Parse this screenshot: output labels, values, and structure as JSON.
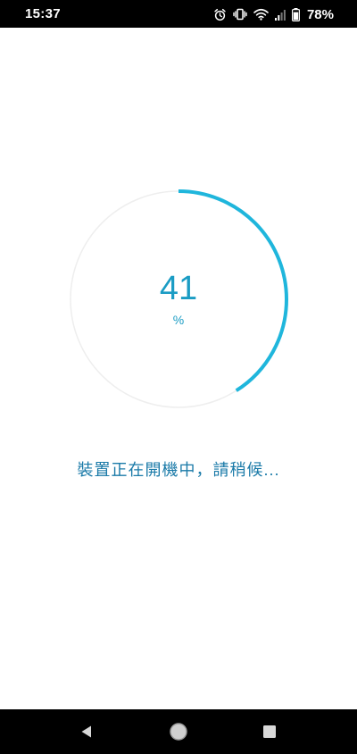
{
  "status_bar": {
    "time": "15:37",
    "battery_percent": "78%",
    "icons": [
      "alarm-icon",
      "vibrate-icon",
      "wifi-icon",
      "cell-signal-icon",
      "battery-icon"
    ]
  },
  "progress": {
    "value": "41",
    "unit": "%",
    "fraction": 0.41,
    "track_color": "#eeeeee",
    "fill_color": "#1fb6dc"
  },
  "message": "裝置正在開機中，請稍候...",
  "nav_bar": {
    "buttons": [
      "back-icon",
      "home-icon",
      "recents-icon"
    ]
  }
}
